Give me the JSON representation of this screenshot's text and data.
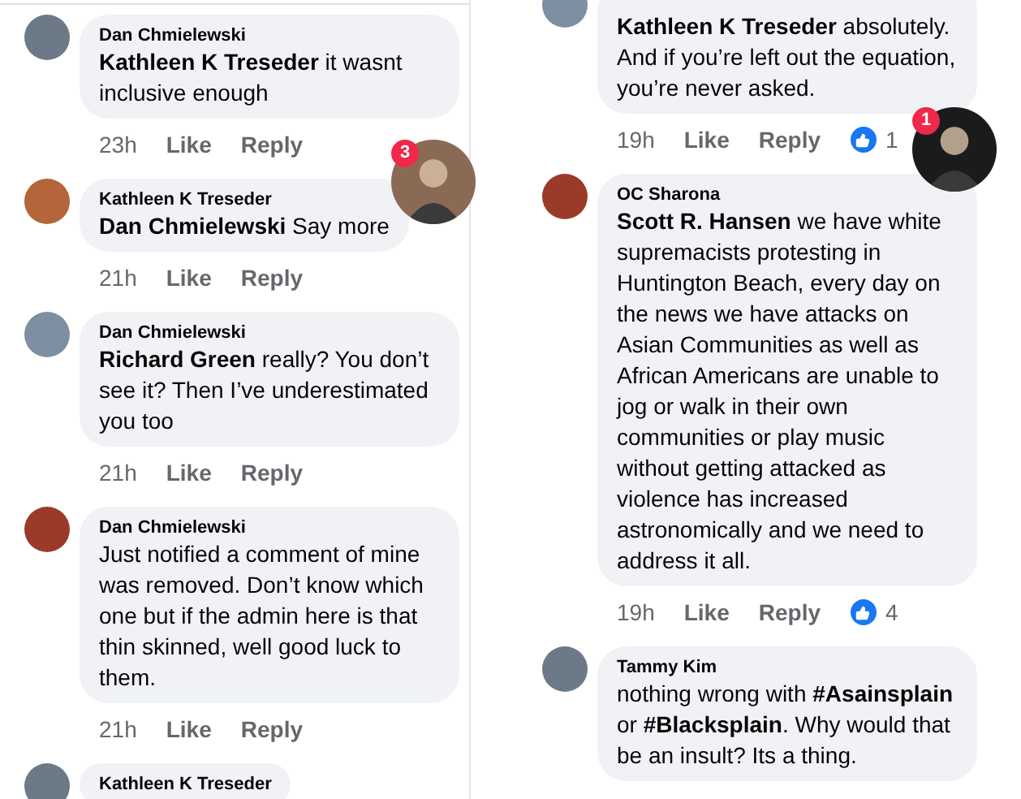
{
  "columns": [
    {
      "comments": [
        {
          "author": "Dan Chmielewski",
          "body": "**Kathleen K Treseder** it wasnt inclusive enough",
          "time": "23h",
          "like": "Like",
          "reply": "Reply"
        },
        {
          "author": "Kathleen K Treseder",
          "body": "**Dan Chmielewski** Say more",
          "time": "21h",
          "like": "Like",
          "reply": "Reply"
        },
        {
          "author": "Dan Chmielewski",
          "body": "**Richard Green** really?  You don’t see it?  Then I’ve underestimated you too",
          "time": "21h",
          "like": "Like",
          "reply": "Reply"
        },
        {
          "author": "Dan Chmielewski",
          "body": "Just notified a comment of mine was removed.  Don’t know which one but if the admin here is that thin skinned, well good luck to them.",
          "time": "21h",
          "like": "Like",
          "reply": "Reply"
        },
        {
          "author": "Kathleen K Treseder"
        }
      ]
    },
    {
      "comments": [
        {
          "body": "**Kathleen K Treseder** absolutely. And if you’re left out the equation, you’re never asked.",
          "time": "19h",
          "like": "Like",
          "reply": "Reply",
          "reactions": "1"
        },
        {
          "author": "OC Sharona",
          "body": "**Scott R. Hansen** we have white supremacists protesting in Huntington Beach, every day on the news we have attacks on Asian Communities as well as African Americans are unable to jog or walk in their own communities or play music without getting attacked as violence has increased astronomically and we need to address it all.",
          "time": "19h",
          "like": "Like",
          "reply": "Reply",
          "reactions": "4"
        },
        {
          "author": "Tammy Kim",
          "body": "nothing wrong with **#Asainsplain** or **#Blacksplain**. Why would that be an insult? Its a thing."
        }
      ]
    }
  ],
  "chat_heads": [
    {
      "badge": "3"
    },
    {
      "badge": "1"
    }
  ]
}
